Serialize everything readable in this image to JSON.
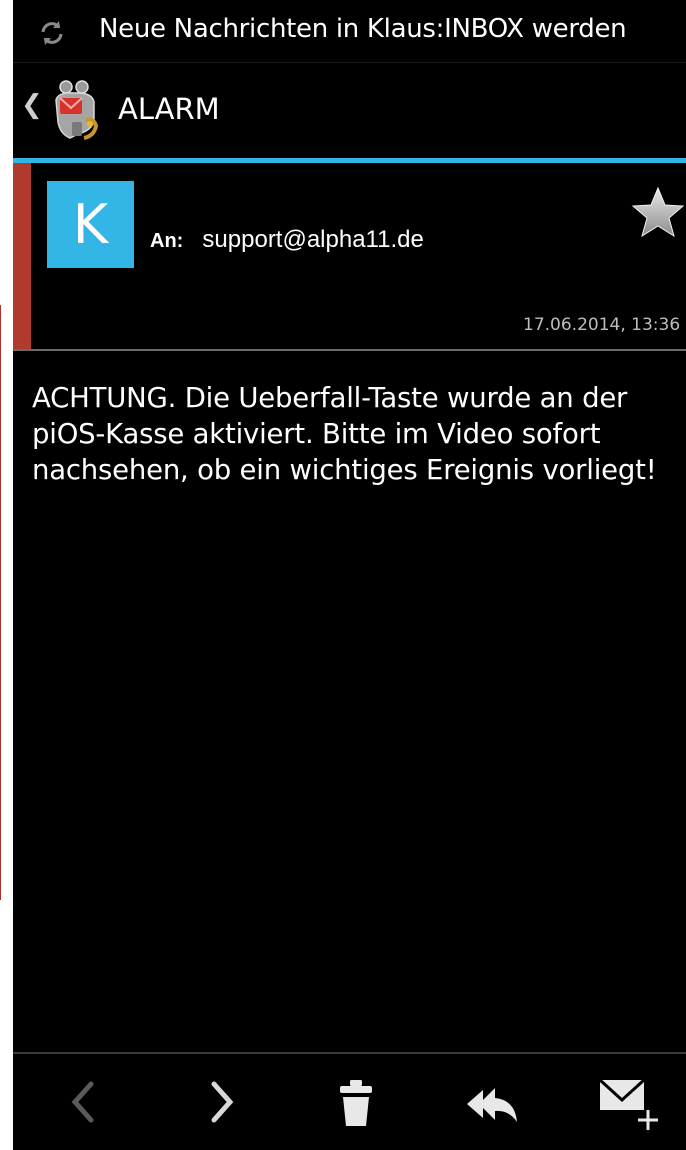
{
  "status_bar": {
    "notification_text": "Neue Nachrichten in Klaus:INBOX werden",
    "icon": "sync-icon"
  },
  "action_bar": {
    "folder_title": "ALARM",
    "back_icon": "chevron-left-icon",
    "app_icon": "k9-mail-dog-icon"
  },
  "message": {
    "avatar_letter": "K",
    "to_label": "An:",
    "to_value": "support@alpha11.de",
    "date": "17.06.2014, 13:36",
    "starred": false,
    "body": "ACHTUNG. Die Ueberfall-Taste wurde an der piOS-Kasse aktiviert. Bitte im Video sofort nachsehen, ob ein wichtiges Ereignis vorliegt!"
  },
  "bottom_bar": {
    "icons": [
      "previous-icon",
      "next-icon",
      "delete-icon",
      "reply-all-icon",
      "compose-icon"
    ]
  },
  "colors": {
    "accent": "#33b5e5",
    "unread_strip": "#b03a2e",
    "background": "#000000",
    "text": "#ffffff"
  }
}
